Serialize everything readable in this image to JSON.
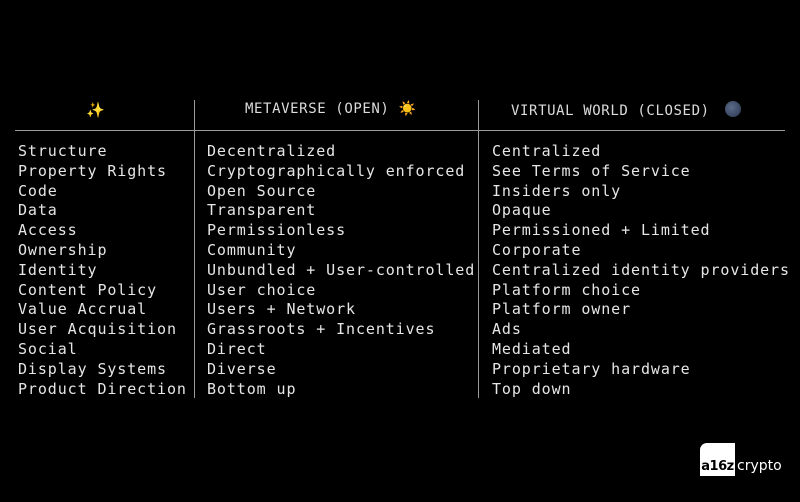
{
  "header": {
    "col1_icon": "sparkles-icon",
    "col1_glyph": "✨",
    "col2_title": "METAVERSE (OPEN)",
    "col2_glyph": "☀️",
    "col3_title": "VIRTUAL WORLD (CLOSED)"
  },
  "rows": [
    {
      "attribute": "Structure",
      "open": "Decentralized",
      "closed": "Centralized"
    },
    {
      "attribute": "Property Rights",
      "open": "Cryptographically enforced",
      "closed": "See Terms of Service"
    },
    {
      "attribute": "Code",
      "open": "Open Source",
      "closed": "Insiders only"
    },
    {
      "attribute": "Data",
      "open": "Transparent",
      "closed": "Opaque"
    },
    {
      "attribute": "Access",
      "open": "Permissionless",
      "closed": "Permissioned + Limited"
    },
    {
      "attribute": "Ownership",
      "open": "Community",
      "closed": "Corporate"
    },
    {
      "attribute": "Identity",
      "open": "Unbundled + User-controlled",
      "closed": "Centralized identity providers"
    },
    {
      "attribute": "Content Policy",
      "open": "User choice",
      "closed": "Platform choice"
    },
    {
      "attribute": "Value Accrual",
      "open": "Users + Network",
      "closed": "Platform owner"
    },
    {
      "attribute": "User Acquisition",
      "open": "Grassroots + Incentives",
      "closed": "Ads"
    },
    {
      "attribute": "Social",
      "open": "Direct",
      "closed": "Mediated"
    },
    {
      "attribute": "Display Systems",
      "open": "Diverse",
      "closed": "Proprietary hardware"
    },
    {
      "attribute": "Product Direction",
      "open": "Bottom up",
      "closed": "Top down"
    }
  ],
  "logo": {
    "mark": "a16z",
    "text": "crypto"
  }
}
